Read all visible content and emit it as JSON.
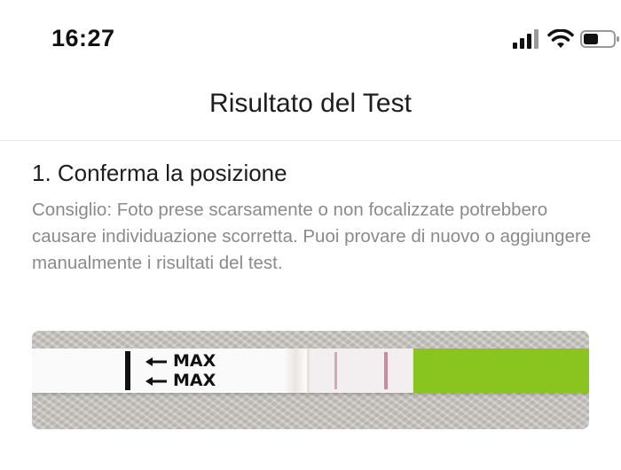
{
  "status_bar": {
    "time": "16:27",
    "icons": [
      "signal-icon",
      "wifi-icon",
      "battery-icon"
    ]
  },
  "nav": {
    "title": "Risultato del Test"
  },
  "section": {
    "title": "1. Conferma la posizione",
    "hint": "Consiglio: Foto prese scarsamente o non focalizzate potrebbero causare individuazione scorretta. Puoi provare di nuovo o aggiungere manualmente i risultati del test."
  },
  "test_photo": {
    "max_labels": [
      "MAX",
      "MAX"
    ],
    "colors": {
      "handle": "#8ac41e",
      "bands": "#c98aa2"
    }
  }
}
